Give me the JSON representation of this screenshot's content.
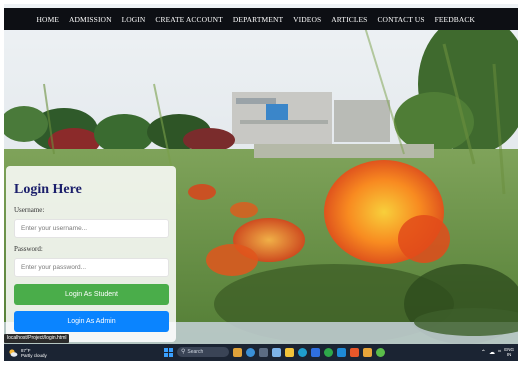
{
  "navbar": {
    "items": [
      "HOME",
      "ADMISSION",
      "LOGIN",
      "CREATE ACCOUNT",
      "DEPARTMENT",
      "VIDEOS",
      "ARTICLES",
      "CONTACT US",
      "FEEDBACK"
    ]
  },
  "login": {
    "title": "Login Here",
    "username_label": "Username:",
    "username_placeholder": "Enter your username...",
    "password_label": "Password:",
    "password_placeholder": "Enter your password...",
    "student_button": "Login As Student",
    "admin_button": "Login As Admin"
  },
  "status_url": "localhost/Project/login.html",
  "taskbar": {
    "weather_temp": "87°F",
    "weather_desc": "Partly cloudy",
    "search_label": "Search",
    "tray_lang": "ENG",
    "tray_region": "IN"
  },
  "colors": {
    "navbar_bg": "#0d0f14",
    "title": "#1b1f6b",
    "student_button": "#4aad4a",
    "admin_button": "#0a84ff",
    "taskbar_bg": "#1b2433"
  }
}
